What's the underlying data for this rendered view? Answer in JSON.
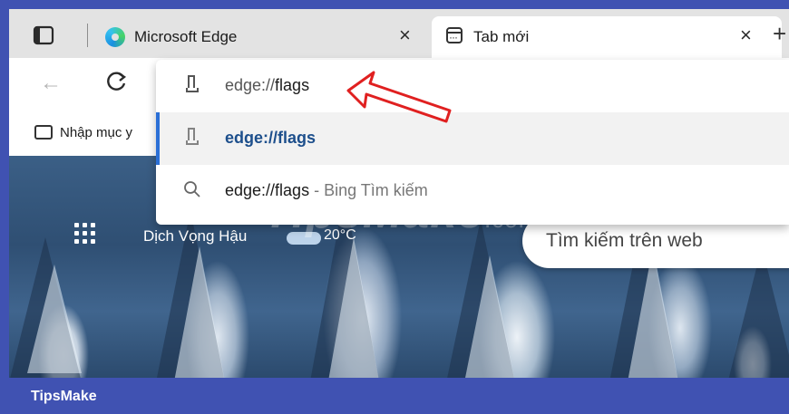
{
  "tabs": [
    {
      "title": "Microsoft Edge",
      "close": "×",
      "active": false
    },
    {
      "title": "Tab mới",
      "close": "×",
      "active": true
    }
  ],
  "new_tab_symbol": "+",
  "toolbar": {
    "back_icon": "←",
    "reload_icon": "C"
  },
  "favorites": {
    "label": "Nhập mục y"
  },
  "omnibox_dropdown": {
    "input_prefix": "edge://",
    "input_rest": "flags",
    "suggestion_bold": "edge://flags",
    "search_prefix": "edge://flags",
    "search_suffix": " - Bing Tìm kiếm"
  },
  "new_tab_page": {
    "location": "Dịch Vọng Hậu",
    "temperature": "20°C",
    "search_placeholder": "Tìm kiếm trên web"
  },
  "watermark": {
    "text": "TipsMake",
    "suffix": ".com"
  },
  "footer": {
    "label": "TipsMake"
  },
  "colors": {
    "frame": "#4052b2",
    "accent": "#2b6fd6",
    "arrow": "#e02020"
  }
}
